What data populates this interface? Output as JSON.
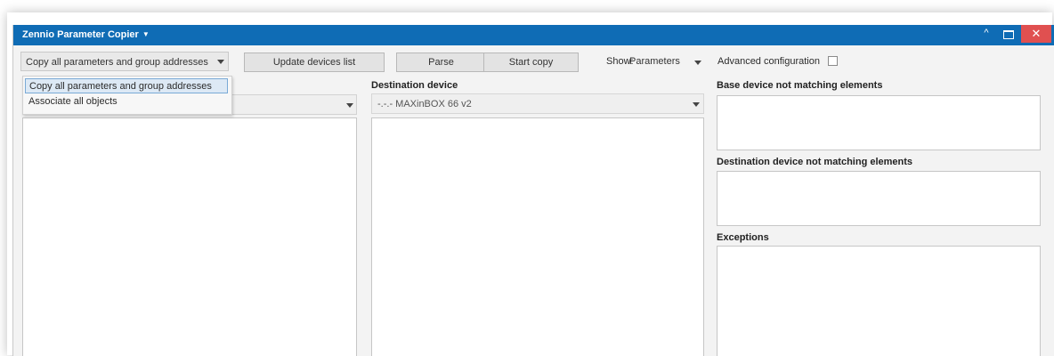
{
  "window": {
    "title": "Zennio Parameter Copier",
    "minimize_glyph": "^",
    "close_glyph": "✕"
  },
  "toolbar": {
    "mode_select_value": "Copy all parameters and group addresses",
    "update_button": "Update devices list",
    "parse_button": "Parse",
    "start_button": "Start copy",
    "show_label": "Show:",
    "show_value": "Parameters",
    "advanced_label": "Advanced configuration"
  },
  "mode_dropdown": {
    "options": [
      "Copy all parameters and group addresses",
      "Associate all objects"
    ]
  },
  "destination": {
    "title": "Destination device",
    "device_value": "-.-.-  MAXinBOX 66 v2"
  },
  "right_panels": {
    "base_title": "Base device not matching elements",
    "dest_title": "Destination device not matching elements",
    "exceptions_title": "Exceptions"
  },
  "colors": {
    "titlebar": "#0f6cb5",
    "close_button": "#e05050",
    "background": "#f3f3f3"
  }
}
